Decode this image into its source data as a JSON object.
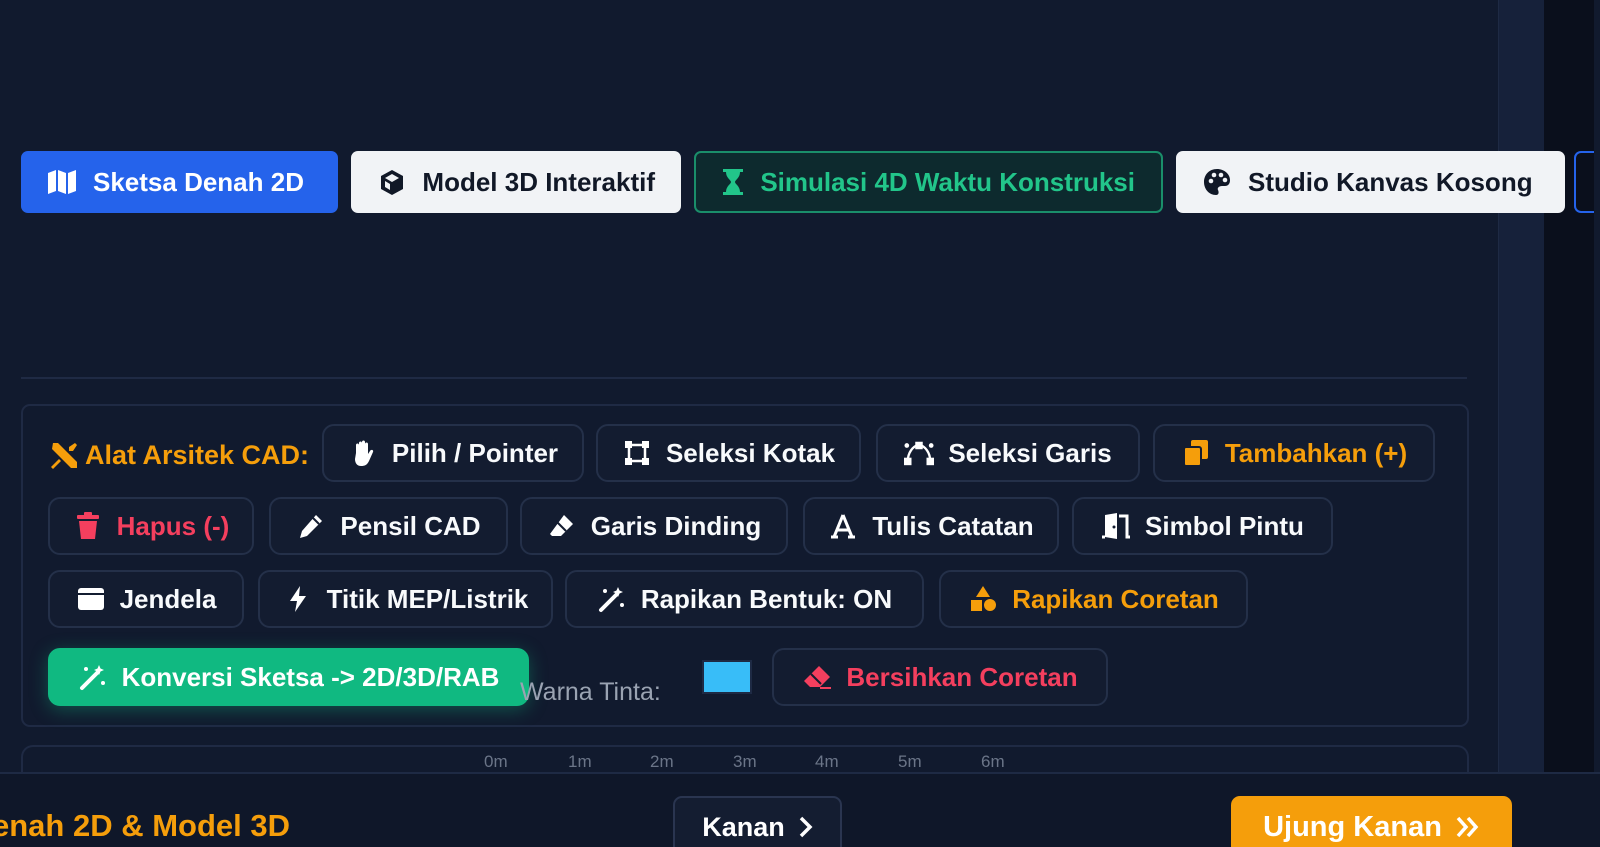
{
  "mode_tabs": [
    {
      "label": "Sketsa Denah 2D",
      "icon": "map-icon"
    },
    {
      "label": "Model 3D Interaktif",
      "icon": "cube-icon"
    },
    {
      "label": "Simulasi 4D Waktu Konstruksi",
      "icon": "hourglass-icon"
    },
    {
      "label": "Studio Kanvas Kosong",
      "icon": "palette-icon"
    }
  ],
  "cad": {
    "title": "Alat Arsitek CAD:",
    "tools": [
      {
        "label": "Pilih / Pointer",
        "icon": "hand-icon"
      },
      {
        "label": "Seleksi Kotak",
        "icon": "vector-square-icon"
      },
      {
        "label": "Seleksi Garis",
        "icon": "bezier-icon"
      },
      {
        "label": "Tambahkan (+)",
        "icon": "copy-icon"
      },
      {
        "label": "Hapus (-)",
        "icon": "trash-icon"
      },
      {
        "label": "Pensil CAD",
        "icon": "pencil-icon"
      },
      {
        "label": "Garis Dinding",
        "icon": "eraser-icon"
      },
      {
        "label": "Tulis Catatan",
        "icon": "font-icon"
      },
      {
        "label": "Simbol Pintu",
        "icon": "door-icon"
      },
      {
        "label": "Jendela",
        "icon": "window-icon"
      },
      {
        "label": "Titik MEP/Listrik",
        "icon": "bolt-icon"
      },
      {
        "label": "Rapikan Bentuk: ON",
        "icon": "magic-wand-icon"
      },
      {
        "label": "Rapikan Coretan",
        "icon": "shapes-icon"
      },
      {
        "label": "Konversi Sketsa -> 2D/3D/RAB",
        "icon": "magic-wand-icon"
      },
      {
        "label": "Bersihkan Coretan",
        "icon": "eraser-icon"
      }
    ],
    "ink_label": "Warna Tinta:",
    "ink_color": "#38bdf8"
  },
  "ruler": [
    "0m",
    "1m",
    "2m",
    "3m",
    "4m",
    "5m",
    "6m"
  ],
  "bottom": {
    "title": "enah 2D & Model 3D",
    "right_label": "Kanan",
    "edge_label": "Ujung Kanan"
  },
  "colors": {
    "accent_blue": "#2563eb",
    "accent_green": "#10b981",
    "accent_orange": "#f59e0b",
    "danger": "#f43f5e"
  }
}
